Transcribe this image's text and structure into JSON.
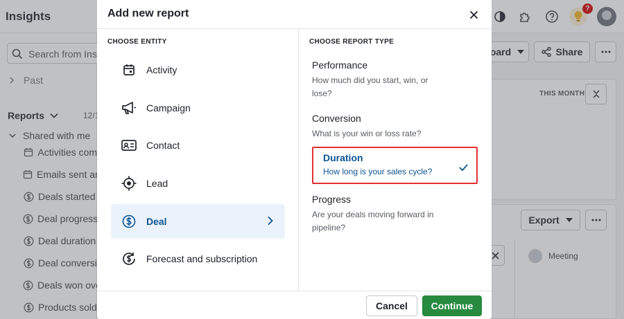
{
  "app": {
    "title": "Insights",
    "search_placeholder": "Search from Insi",
    "nav_past": "Past",
    "reports_heading": "Reports",
    "reports_date_peek": "12/1",
    "shared_with_me": "Shared with me",
    "shared_items": [
      {
        "label": "Activities com",
        "icon": "calendar-icon"
      },
      {
        "label": "Emails sent an",
        "icon": "calendar-icon"
      },
      {
        "label": "Deals started",
        "icon": "dollar-circle-icon"
      },
      {
        "label": "Deal progress",
        "icon": "dollar-circle-icon"
      },
      {
        "label": "Deal duration",
        "icon": "dollar-circle-icon"
      },
      {
        "label": "Deal conversi",
        "icon": "dollar-circle-icon"
      },
      {
        "label": "Deals won ove",
        "icon": "dollar-circle-icon"
      },
      {
        "label": "Products sold",
        "icon": "dollar-circle-icon"
      }
    ],
    "dashboard_btn": "oard",
    "share_btn": "Share",
    "this_month": "THIS MONTH",
    "export_btn": "Export",
    "meeting_label": "Meeting",
    "help_badge": "?"
  },
  "modal": {
    "title": "Add new report",
    "entity_label": "CHOOSE ENTITY",
    "report_type_label": "CHOOSE REPORT TYPE",
    "entities": [
      {
        "label": "Activity",
        "icon": "calendar-icon"
      },
      {
        "label": "Campaign",
        "icon": "megaphone-icon"
      },
      {
        "label": "Contact",
        "icon": "contact-card-icon"
      },
      {
        "label": "Lead",
        "icon": "target-icon"
      },
      {
        "label": "Deal",
        "icon": "dollar-circle-icon",
        "selected": true
      },
      {
        "label": "Forecast and subscription",
        "icon": "forecast-dollar-icon"
      }
    ],
    "report_types": [
      {
        "title": "Performance",
        "description": "How much did you start, win, or lose?"
      },
      {
        "title": "Conversion",
        "description": "What is your win or loss rate?"
      },
      {
        "title": "Duration",
        "description": "How long is your sales cycle?",
        "selected": true
      },
      {
        "title": "Progress",
        "description": "Are your deals moving forward in pipeline?"
      }
    ],
    "cancel_label": "Cancel",
    "continue_label": "Continue"
  },
  "colors": {
    "accent": "#0b5394",
    "selected_bg": "#eaf3fb",
    "highlight_box": "#e52f2f",
    "primary_button": "#268a3f"
  }
}
